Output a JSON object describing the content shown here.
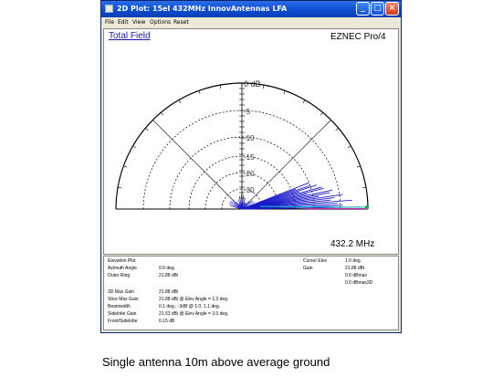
{
  "window": {
    "title": "2D Plot: 15el 432MHz InnovAntennas LFA"
  },
  "menu": [
    "File",
    "Edit",
    "View",
    "Options",
    "Reset"
  ],
  "plot": {
    "plot_type": "Total Field",
    "program": "EZNEC Pro/4",
    "frequency": "432.2 MHz",
    "ring_labels": [
      "0 dB",
      "-5",
      "-10",
      "-15",
      "-20",
      "-30"
    ]
  },
  "info": {
    "left": [
      {
        "label": "Elevation Plot",
        "value": ""
      },
      {
        "label": "Azimuth Angle",
        "value": "0.0 deg."
      },
      {
        "label": "Outer Ring",
        "value": "21.88 dBi"
      },
      {
        "label": "3D Max Gain",
        "value": "21.88 dBi"
      },
      {
        "label": "Slice Max Gain",
        "value": "21.88 dBi @ Elev Angle = 1.0 deg."
      },
      {
        "label": "Beamwidth",
        "value": "0.1 deg.; -3dB @ 1.0, 1.1 deg."
      },
      {
        "label": "Sidelobe Gain",
        "value": "21.53 dBi @ Elev Angle = 3.0 deg."
      },
      {
        "label": "Front/Sidelobe",
        "value": "0.15 dB"
      }
    ],
    "right": [
      {
        "label": "Cursor Elev",
        "value": "1.0 deg."
      },
      {
        "label": "Gain",
        "value": "21.88 dBi"
      },
      {
        "label": "",
        "value": "0.0 dBmax"
      },
      {
        "label": "",
        "value": "0.0 dBmax3D"
      }
    ]
  },
  "caption": "Single antenna 10m above average ground",
  "colors": {
    "title_bar": "#0a4bd0",
    "pattern": "#1a1acc",
    "plot_type_link": "#1a1aa8",
    "close_button": "#d2391b"
  },
  "icons": [
    "minimize-icon",
    "maximize-icon",
    "close-icon",
    "window-app-icon"
  ]
}
